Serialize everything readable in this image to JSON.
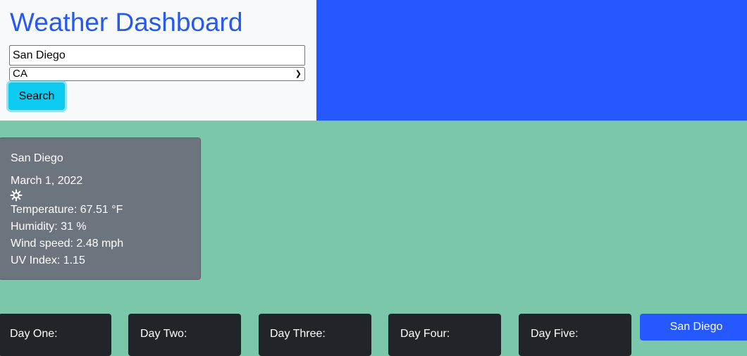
{
  "header": {
    "title": "Weather Dashboard"
  },
  "search": {
    "city_value": "San Diego",
    "state_selected": "CA",
    "button_label": "Search"
  },
  "current": {
    "city": "San Diego",
    "date": "March 1, 2022",
    "icon": "sun-icon",
    "temperature": "Temperature: 67.51 °F",
    "humidity": "Humidity: 31 %",
    "wind": "Wind speed: 2.48 mph",
    "uv": "UV Index: 1.15"
  },
  "forecast": [
    {
      "label": "Day One:"
    },
    {
      "label": "Day Two:"
    },
    {
      "label": "Day Three:"
    },
    {
      "label": "Day Four:"
    },
    {
      "label": "Day Five:"
    }
  ],
  "history": [
    {
      "label": "San Diego"
    }
  ],
  "colors": {
    "accent": "#2559ff",
    "info": "#0dcaf0",
    "background": "#7bc7a9",
    "card_secondary": "#6c757d",
    "card_dark": "#212529"
  }
}
